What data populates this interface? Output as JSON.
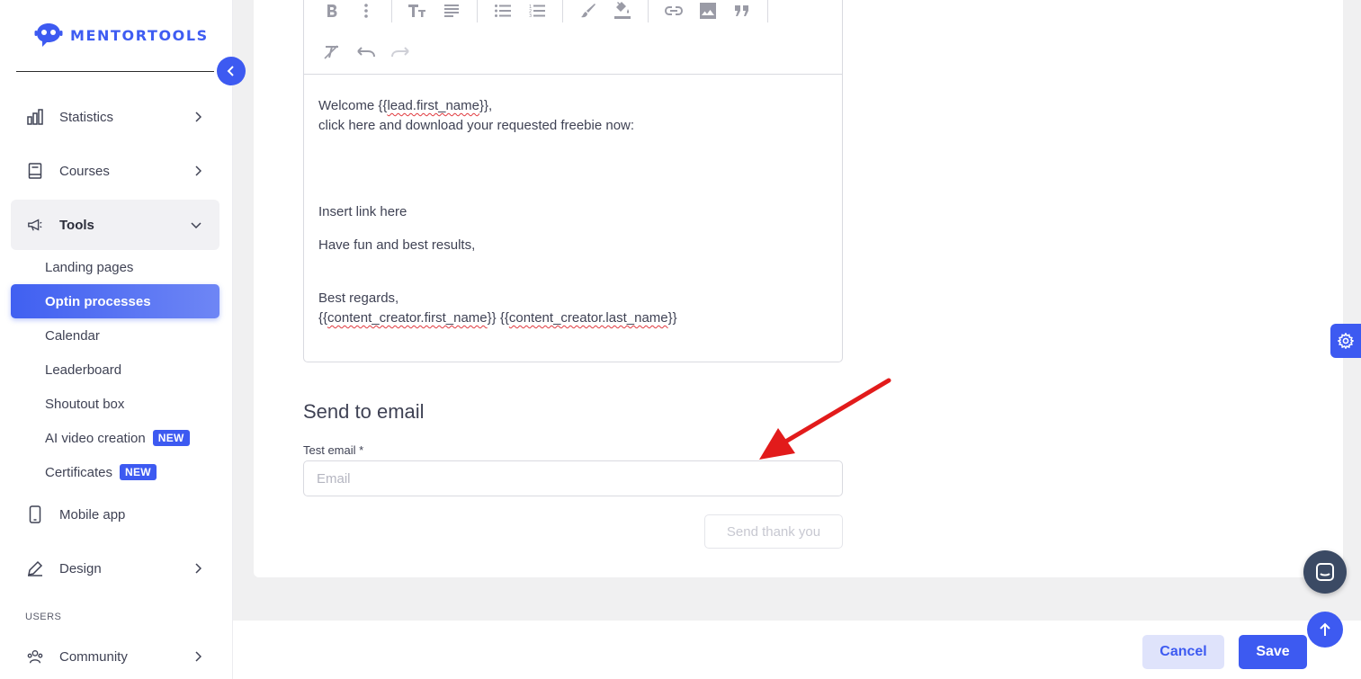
{
  "brand": {
    "name": "MENTORTOOLS",
    "accent": "#3d5af1"
  },
  "sidebar": {
    "nav": [
      {
        "label": "Statistics",
        "icon": "bar-chart-icon"
      },
      {
        "label": "Courses",
        "icon": "book-icon"
      },
      {
        "label": "Tools",
        "icon": "megaphone-icon"
      }
    ],
    "tools_sub": [
      {
        "label": "Landing pages"
      },
      {
        "label": "Optin processes"
      },
      {
        "label": "Calendar"
      },
      {
        "label": "Leaderboard"
      },
      {
        "label": "Shoutout box"
      },
      {
        "label": "AI video creation",
        "badge": "NEW"
      },
      {
        "label": "Certificates",
        "badge": "NEW"
      }
    ],
    "nav2": [
      {
        "label": "Mobile app",
        "icon": "phone-icon"
      },
      {
        "label": "Design",
        "icon": "pencil-icon"
      }
    ],
    "users_section": "USERS",
    "community": {
      "label": "Community",
      "icon": "community-icon"
    }
  },
  "editor": {
    "line1_pre": "Welcome {{",
    "line1_var": "lead.first_name",
    "line1_post": "}},",
    "line2": "click here and download your requested freebie now:",
    "line3": "Insert link here",
    "line4": "Have fun and best results,",
    "line5": "Best regards,",
    "sig_pre1": "{{",
    "sig_var1": "content_creator.first_name",
    "sig_mid": "}} {{",
    "sig_var2": "content_creator.last_name",
    "sig_post": "}}"
  },
  "send_section": {
    "title": "Send to email",
    "field_label": "Test email *",
    "placeholder": "Email",
    "value": "",
    "send_button": "Send thank you"
  },
  "footer": {
    "cancel": "Cancel",
    "save": "Save"
  }
}
